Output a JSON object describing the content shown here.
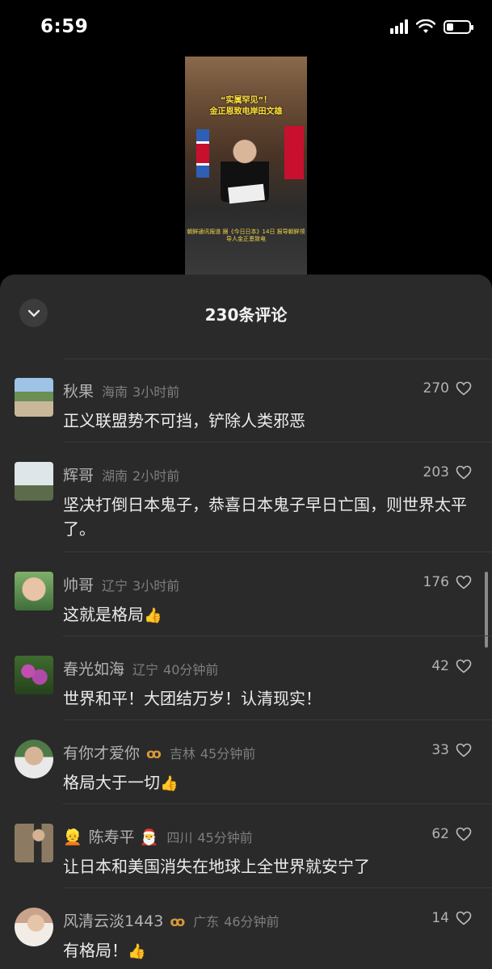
{
  "status_bar": {
    "time": "6:59",
    "battery_level": 0.3
  },
  "video": {
    "title_line1": "“实属罕见”！",
    "title_line2": "金正恩致电岸田文雄",
    "caption": "朝鲜通讯报道 据《今日日本》14日 报导朝鲜领导人金正恩致电"
  },
  "comments_header": {
    "title": "230条评论"
  },
  "comments": [
    {
      "username": "秋果",
      "location": "海南",
      "time": "3小时前",
      "text": "正义联盟势不可挡，铲除人类邪恶",
      "likes": "270"
    },
    {
      "username": "辉哥",
      "location": "湖南",
      "time": "2小时前",
      "text": "坚决打倒日本鬼子，恭喜日本鬼子早日亡国，则世界太平了。",
      "likes": "203"
    },
    {
      "username": "帅哥",
      "location": "辽宁",
      "time": "3小时前",
      "text": "这就是格局",
      "emoji": "👍",
      "likes": "176"
    },
    {
      "username": "春光如海",
      "location": "辽宁",
      "time": "40分钟前",
      "text": "世界和平！大团结万岁！认清现实！",
      "likes": "42"
    },
    {
      "username": "有你才爱你",
      "badge": "ꝏ",
      "location": "吉林",
      "time": "45分钟前",
      "text": "格局大于一切",
      "emoji": "👍",
      "likes": "33"
    },
    {
      "username": "陈寿平",
      "prefix_emoji": "👱",
      "suffix_emoji": "🎅",
      "location": "四川",
      "time": "45分钟前",
      "text": "让日本和美国消失在地球上全世界就安宁了",
      "likes": "62"
    },
    {
      "username": "风清云淡1443",
      "badge": "ꝏ",
      "location": "广东",
      "time": "46分钟前",
      "text": "有格局！",
      "emoji": "👍",
      "likes": "14"
    }
  ],
  "colors": {
    "sheet_bg": "#2a2a2a",
    "badge": "#d79a37",
    "text_primary": "#ececec",
    "text_secondary": "#b3b3b3"
  },
  "icons": {
    "collapse": "chevron-down-icon",
    "like": "heart-outline-icon",
    "signal": "signal-icon",
    "wifi": "wifi-icon",
    "battery": "battery-icon"
  }
}
